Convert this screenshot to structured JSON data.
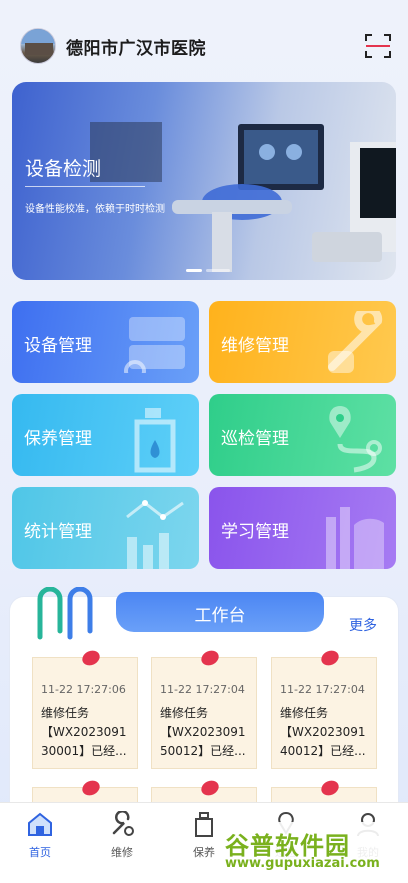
{
  "header": {
    "title": "德阳市广汉市医院",
    "avatar_icon": "hospital-avatar",
    "scan_icon": "scan-icon"
  },
  "banner": {
    "title": "设备检测",
    "subtitle": "设备性能校准，依赖于时时检测",
    "slides": 3,
    "active_slide": 1
  },
  "menu": [
    {
      "label": "设备管理",
      "icon": "device-icon",
      "color_from": "#3e6ff0",
      "color_to": "#6aa0f8"
    },
    {
      "label": "维修管理",
      "icon": "wrench-icon",
      "color_from": "#ffb21c",
      "color_to": "#ffc94f"
    },
    {
      "label": "保养管理",
      "icon": "bottle-icon",
      "color_from": "#35b9f0",
      "color_to": "#5fd0f8"
    },
    {
      "label": "巡检管理",
      "icon": "route-icon",
      "color_from": "#2fce8a",
      "color_to": "#5ee0a4"
    },
    {
      "label": "统计管理",
      "icon": "chart-icon",
      "color_from": "#4fc6e7",
      "color_to": "#7dd6ee"
    },
    {
      "label": "学习管理",
      "icon": "book-icon",
      "color_from": "#8a54ec",
      "color_to": "#a67bf3"
    }
  ],
  "workbench": {
    "title": "工作台",
    "more": "更多",
    "cards": [
      {
        "time": "11-22 17:27:06",
        "type": "维修任务",
        "line2": "【WX2023091",
        "line3": "30001】已经..."
      },
      {
        "time": "11-22 17:27:04",
        "type": "维修任务",
        "line2": "【WX2023091",
        "line3": "50012】已经..."
      },
      {
        "time": "11-22 17:27:04",
        "type": "维修任务",
        "line2": "【WX2023091",
        "line3": "40012】已经..."
      }
    ]
  },
  "tabbar": {
    "tabs": [
      {
        "label": "首页",
        "icon": "home-icon",
        "active": true
      },
      {
        "label": "维修",
        "icon": "wrench-icon",
        "active": false
      },
      {
        "label": "保养",
        "icon": "bottle-icon",
        "active": false
      },
      {
        "label": "巡检",
        "icon": "location-icon",
        "active": false
      },
      {
        "label": "我的",
        "icon": "user-icon",
        "active": false
      }
    ]
  },
  "watermark": {
    "brand": "谷普软件园",
    "url": "www.gupuxiazai.com"
  },
  "colors": {
    "accent": "#2f63e0",
    "pin": "#e4344e"
  }
}
